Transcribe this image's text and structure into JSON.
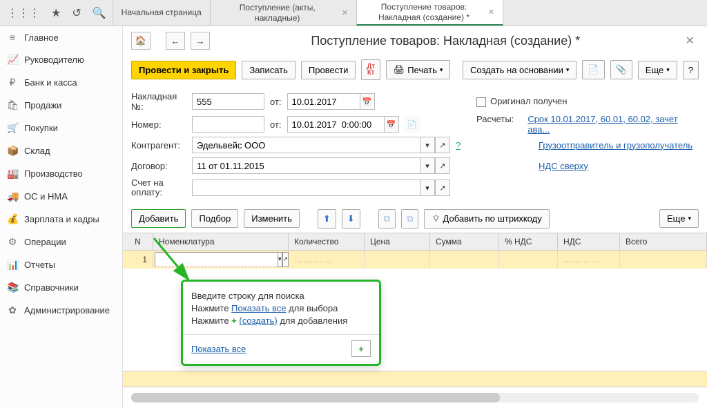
{
  "topbar": {
    "tabs": [
      {
        "label": "Начальная страница",
        "closable": false
      },
      {
        "label": "Поступление (акты, накладные)",
        "closable": true
      },
      {
        "label": "Поступление товаров: Накладная (создание) *",
        "closable": true,
        "active": true
      }
    ]
  },
  "sidebar": {
    "items": [
      {
        "icon": "≡",
        "label": "Главное"
      },
      {
        "icon": "📈",
        "label": "Руководителю"
      },
      {
        "icon": "₽",
        "label": "Банк и касса"
      },
      {
        "icon": "🛍",
        "label": "Продажи"
      },
      {
        "icon": "🛒",
        "label": "Покупки"
      },
      {
        "icon": "📦",
        "label": "Склад"
      },
      {
        "icon": "🏭",
        "label": "Производство"
      },
      {
        "icon": "🚚",
        "label": "ОС и НМА"
      },
      {
        "icon": "💰",
        "label": "Зарплата и кадры"
      },
      {
        "icon": "⚙",
        "label": "Операции"
      },
      {
        "icon": "📊",
        "label": "Отчеты"
      },
      {
        "icon": "📚",
        "label": "Справочники"
      },
      {
        "icon": "✿",
        "label": "Администрирование"
      }
    ]
  },
  "page": {
    "title": "Поступление товаров: Накладная (создание) *"
  },
  "toolbar": {
    "post_close": "Провести и закрыть",
    "write": "Записать",
    "post": "Провести",
    "print": "Печать",
    "create_based": "Создать на основании",
    "more": "Еще"
  },
  "form": {
    "invoice_label": "Накладная №:",
    "invoice_value": "555",
    "from_label": "от:",
    "invoice_date": "10.01.2017",
    "original_received": "Оригинал получен",
    "number_label": "Номер:",
    "number_date": "10.01.2017  0:00:00",
    "settlements_label": "Расчеты:",
    "settlements_link": "Срок 10.01.2017, 60.01, 60.02, зачет ава...",
    "counterparty_label": "Контрагент:",
    "counterparty_value": "Эдельвейс ООО",
    "shipper_link": "Грузоотправитель и грузополучатель",
    "contract_label": "Договор:",
    "contract_value": "11 от 01.11.2015",
    "vat_link": "НДС сверху",
    "invoice_pay_label": "Счет на оплату:"
  },
  "table_toolbar": {
    "add": "Добавить",
    "select": "Подбор",
    "edit": "Изменить",
    "barcode": "Добавить по штрихкоду",
    "more": "Еще"
  },
  "grid": {
    "columns": {
      "n": "N",
      "nom": "Номенклатура",
      "qty": "Количество",
      "price": "Цена",
      "sum": "Сумма",
      "vatp": "% НДС",
      "vat": "НДС",
      "total": "Всего"
    },
    "row1_n": "1"
  },
  "popup": {
    "line1": "Введите строку для поиска",
    "line2_a": "Нажмите ",
    "line2_link": "Показать все",
    "line2_b": " для выбора",
    "line3_a": "Нажмите ",
    "line3_link": "(создать)",
    "line3_b": " для добавления",
    "show_all": "Показать все"
  }
}
